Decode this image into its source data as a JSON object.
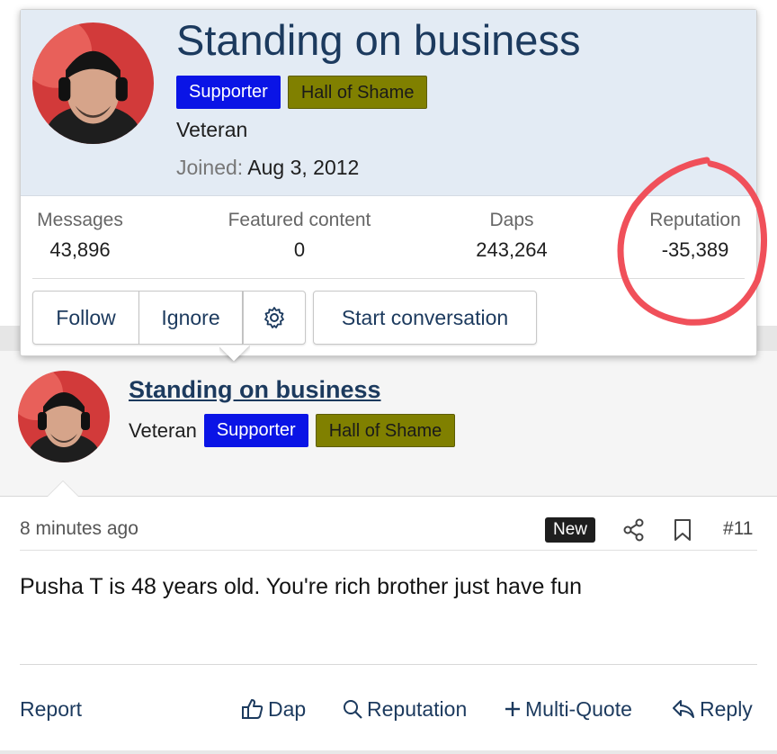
{
  "popup": {
    "username": "Standing on business",
    "badges": {
      "supporter": "Supporter",
      "shame": "Hall of Shame"
    },
    "user_title": "Veteran",
    "joined_label": "Joined:",
    "joined_value": "Aug 3, 2012",
    "stats": {
      "messages": {
        "label": "Messages",
        "value": "43,896"
      },
      "featured": {
        "label": "Featured content",
        "value": "0"
      },
      "daps": {
        "label": "Daps",
        "value": "243,264"
      },
      "reputation": {
        "label": "Reputation",
        "value": "-35,389"
      }
    },
    "buttons": {
      "follow": "Follow",
      "ignore": "Ignore",
      "settings_icon": "gear-icon",
      "start_conversation": "Start conversation"
    }
  },
  "post": {
    "username": "Standing on business",
    "user_title": "Veteran",
    "badges": {
      "supporter": "Supporter",
      "shame": "Hall of Shame"
    },
    "time": "8 minutes ago",
    "new_badge": "New",
    "number": "#11",
    "content": "Pusha T is 48 years old. You're rich brother just have fun",
    "actions": {
      "report": "Report",
      "dap": "Dap",
      "reputation": "Reputation",
      "multiquote": "Multi-Quote",
      "reply": "Reply"
    }
  },
  "colors": {
    "supporter_badge": "#0a14e6",
    "shame_badge": "#808000",
    "link": "#1c3a5e",
    "popup_header_bg": "#e3ebf4",
    "annotation_circle": "#f0505a"
  }
}
